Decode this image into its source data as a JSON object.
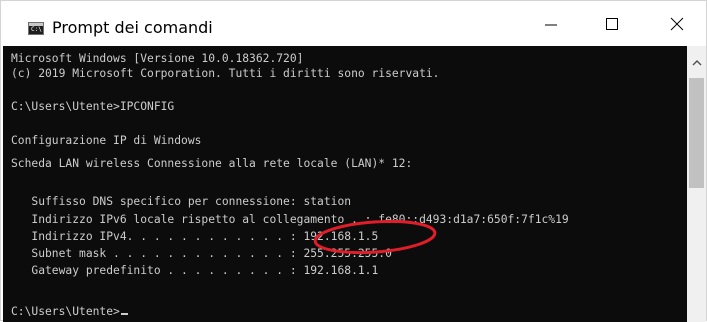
{
  "window": {
    "title": "Prompt dei comandi",
    "app_icon_text": "C:\\"
  },
  "console": {
    "lines": [
      "Microsoft Windows [Versione 10.0.18362.720]",
      "(c) 2019 Microsoft Corporation. Tutti i diritti sono riservati.",
      "",
      "C:\\Users\\Utente>IPCONFIG",
      "",
      "Configurazione IP di Windows",
      "",
      "Scheda LAN wireless Connessione alla rete locale (LAN)* 12:",
      "",
      "   Suffisso DNS specifico per connessione: station",
      "   Indirizzo IPv6 locale rispetto al collegamento . : fe80::d493:d1a7:650f:7f1c%19",
      "   Indirizzo IPv4. . . . . . . . . . . . : 192.168.1.5",
      "   Subnet mask . . . . . . . . . . . . . : 255.255.255.0",
      "   Gateway predefinito . . . . . . . . . : 192.168.1.1",
      "",
      "",
      "C:\\Users\\Utente>"
    ]
  },
  "colors": {
    "console_bg": "#0c0c0c",
    "console_text": "#cccccc",
    "annotation_ring": "#e21d2a"
  },
  "icons": {
    "minimize": "minimize-icon",
    "maximize": "maximize-icon",
    "close": "close-icon",
    "scroll_up": "chevron-up-icon"
  }
}
